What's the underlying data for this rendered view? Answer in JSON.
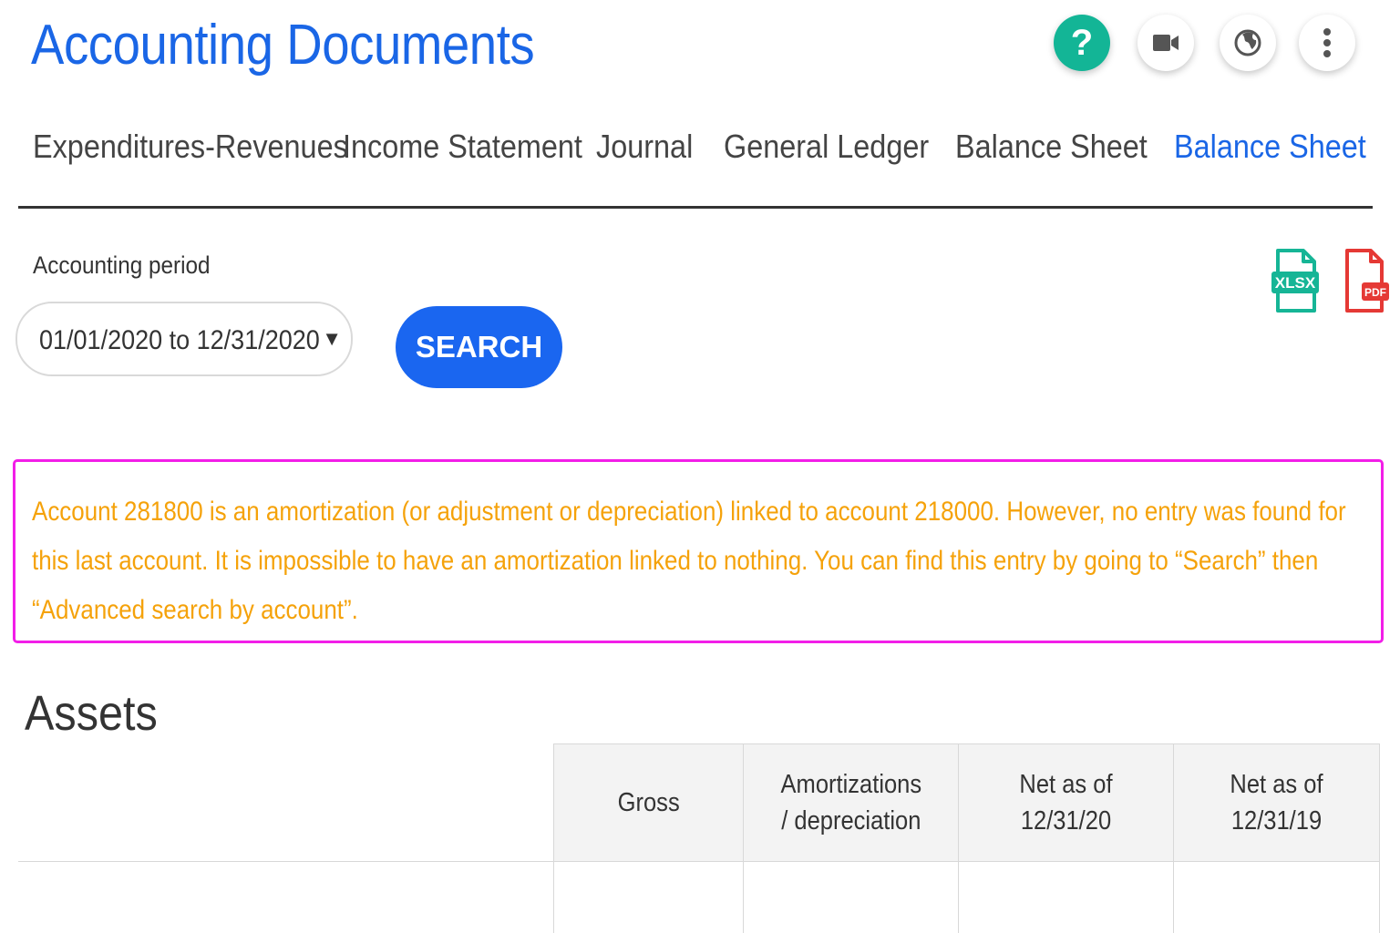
{
  "header": {
    "title": "Accounting Documents",
    "help_label": "?"
  },
  "tabs": [
    {
      "label": "Expenditures-Revenues"
    },
    {
      "label": "Income Statement"
    },
    {
      "label": "Journal"
    },
    {
      "label": "General Ledger"
    },
    {
      "label": "Balance Sheet"
    },
    {
      "label": "Balance Sheet",
      "active": true
    }
  ],
  "period": {
    "label": "Accounting period",
    "value": "01/01/2020 to 12/31/2020"
  },
  "search_button": "SEARCH",
  "exports": {
    "xlsx_label": "XLSX",
    "pdf_label": "PDF"
  },
  "alert": {
    "message": "Account 281800 is an amortization (or adjustment or depreciation) linked to account 218000. However, no entry was found for this last account. It is impossible to have an amortization linked to nothing. You can find this entry by going to “Search” then “Advanced search by account”."
  },
  "assets": {
    "title": "Assets",
    "columns": [
      "Gross",
      "Amortizations / depreciation",
      "Net as of 12/31/20",
      "Net as of 12/31/19"
    ]
  },
  "colors": {
    "brand_blue": "#1a66e6",
    "help_green": "#13b596",
    "alert_border": "#f21ee8",
    "alert_text": "#f5a20a",
    "xlsx_green": "#16b596",
    "pdf_red": "#e53935"
  },
  "icons": {
    "help": "help-icon",
    "video": "video-camera-icon",
    "globe": "globe-icon",
    "more": "more-vertical-icon",
    "xlsx": "xlsx-file-icon",
    "pdf": "pdf-file-icon",
    "dropdown": "chevron-down-icon"
  }
}
